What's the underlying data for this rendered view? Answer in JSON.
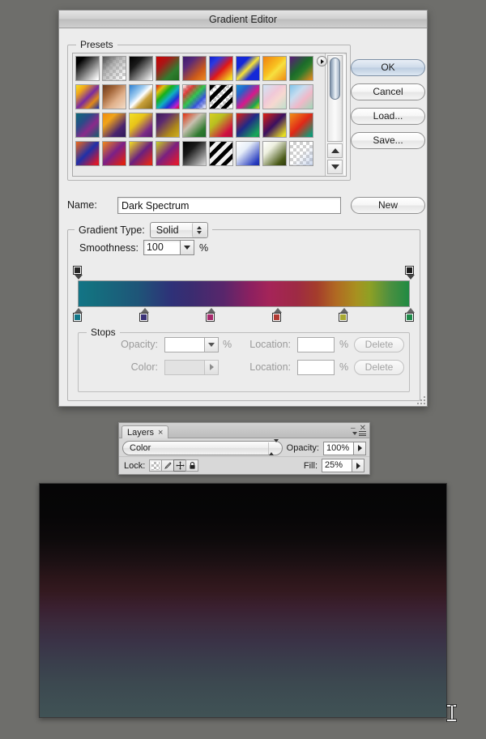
{
  "dialog": {
    "title": "Gradient Editor",
    "buttons": {
      "ok": "OK",
      "cancel": "Cancel",
      "load": "Load...",
      "save": "Save...",
      "new": "New"
    },
    "presets": {
      "title": "Presets",
      "swatches": [
        {
          "name": "black-white",
          "css": "linear-gradient(135deg,#000 0%,#000 18%,#ffffff 95%)"
        },
        {
          "name": "foreground-to-transparent",
          "css": "linear-gradient(135deg,#4d4d4d 0%,rgba(160,160,160,0.75) 40%,rgba(255,255,255,0) 92%)"
        },
        {
          "name": "black-white-soft",
          "css": "linear-gradient(135deg,#000 0%,#1a1a1a 30%,#ffffff 100%)"
        },
        {
          "name": "red-green",
          "css": "linear-gradient(135deg,#cc0000 0%,#a81818 30%,#2f7d2f 70%,#1e6b1e 100%)"
        },
        {
          "name": "violet-orange",
          "css": "linear-gradient(135deg,#3b1a6e 0%,#5a2a78 28%,#cc5a1a 70%,#ef8a1e 100%)"
        },
        {
          "name": "blue-red-yellow",
          "css": "linear-gradient(135deg,#1020d0 0%,#2a3ae0 22%,#e01818 55%,#f0d020 90%,#f8e840 100%)"
        },
        {
          "name": "blue-yellow-blue",
          "css": "linear-gradient(135deg,#1428d8 0%,#1428d8 28%,#f5e238 50%,#1428d8 72%,#1428d8 100%)"
        },
        {
          "name": "orange-yellow-orange",
          "css": "linear-gradient(135deg,#f08010 0%,#f8c020 45%,#f7e040 58%,#ef8a14 100%)"
        },
        {
          "name": "violet-green-orange",
          "css": "linear-gradient(135deg,#5c1a7a 0%,#1c6b2a 45%,#2b7a2b 60%,#ef8a1e 100%)"
        },
        {
          "name": "yellow-violet-orange-blue",
          "css": "linear-gradient(135deg,#f6e020 0%,#f0a81a 22%,#7a2aa0 52%,#e08a18 74%,#1a2ea8 100%)"
        },
        {
          "name": "copper",
          "css": "linear-gradient(135deg,#6b3a1e 0%,#a4673a 30%,#e0b08a 62%,#f3ddc8 100%)"
        },
        {
          "name": "chrome",
          "css": "linear-gradient(135deg,#2a7fd0 0%,#9ecbf0 34%,#ffffff 50%,#c8a03a 66%,#8a6a14 100%)"
        },
        {
          "name": "spectrum",
          "css": "linear-gradient(135deg,#e01010 0%,#e0c010 18%,#18b018 36%,#10b0c0 54%,#2030d8 72%,#c020c8 88%,#e01010 100%)"
        },
        {
          "name": "transparent-rainbow",
          "css": "linear-gradient(135deg,rgba(255,0,0,0) 0%,rgba(220,30,30,.85) 22%,rgba(30,190,60,.9) 48%,rgba(40,70,220,.9) 72%,rgba(200,40,200,0) 100%)"
        },
        {
          "name": "transparent-stripes",
          "css": "repeating-linear-gradient(135deg,#000 0 5px,rgba(255,255,255,0) 5px 10px)"
        },
        {
          "name": "blue-magenta-green",
          "css": "linear-gradient(135deg,#1896d8 0%,#2a60c8 26%,#d8188c 56%,#18a84c 82%,#ead818 100%)"
        },
        {
          "name": "pastel-pink",
          "css": "linear-gradient(135deg,#cfe4f5 0%,#f0c8d8 40%,#f6d8d0 62%,#bfe0cc 100%)"
        },
        {
          "name": "pastel-blue-pink",
          "css": "linear-gradient(135deg,#7fc4ea 0%,#c8dcef 34%,#f0b8c8 62%,#9fd8b8 100%)"
        },
        {
          "name": "teal-violet",
          "css": "linear-gradient(135deg,#0d6a78 0%,#2c4a88 34%,#8a2a8a 62%,#14606e 100%)"
        },
        {
          "name": "orange-violet",
          "css": "linear-gradient(135deg,#ef8a10 0%,#f0a418 28%,#4a2470 70%,#2e1a58 100%)"
        },
        {
          "name": "yellow-violet",
          "css": "linear-gradient(135deg,#f2e028 0%,#e8c418 35%,#7a2a88 75%,#5a1c6c 100%)"
        },
        {
          "name": "violet-olive",
          "css": "linear-gradient(135deg,#3a1a5c 0%,#5c2a70 30%,#b08a18 72%,#d0b020 100%)"
        },
        {
          "name": "red-gray-green",
          "css": "linear-gradient(135deg,#e03010 0%,#c8c0b0 40%,#2f7a2f 78%,#1e6a2a 100%)"
        },
        {
          "name": "olive-crimson",
          "css": "linear-gradient(135deg,#d8d020 0%,#b8c020 32%,#d01040 78%,#b01038 100%)"
        },
        {
          "name": "red-navy-green",
          "css": "linear-gradient(135deg,#e02010 0%,#202a88 46%,#18a858 88%,#14904c 100%)"
        },
        {
          "name": "red-violet-yellow",
          "css": "linear-gradient(135deg,#e02010 0%,#3a1060 48%,#e8e020 92%,#d8d018 100%)"
        },
        {
          "name": "orange-red-teal",
          "css": "linear-gradient(135deg,#f09018 0%,#e02818 48%,#109a78 92%,#0c8a6c 100%)"
        },
        {
          "name": "orange-blue-red",
          "css": "linear-gradient(135deg,#f06818 0%,#2030a8 48%,#e01828 92%,#d01020 100%)"
        },
        {
          "name": "orange-violet-red",
          "css": "linear-gradient(135deg,#f08818 0%,#7a2088 48%,#e02010 92%,#d01808 100%)"
        },
        {
          "name": "yellow-violet-red",
          "css": "linear-gradient(135deg,#f3e020 0%,#6a2080 50%,#e02818 92%,#d02010 100%)"
        },
        {
          "name": "olive-violet-red",
          "css": "linear-gradient(135deg,#c8d020 0%,#7a2080 48%,#e01830 92%,#d01028 100%)"
        },
        {
          "name": "black-gray",
          "css": "linear-gradient(135deg,#000 0%,#1a1a1a 34%,#b8b8b8 88%,#d8d8d8 100%)"
        },
        {
          "name": "black-stripes",
          "css": "repeating-linear-gradient(135deg,#000 0 5px,#f2f2f2 5px 10px)"
        },
        {
          "name": "white-blue",
          "css": "linear-gradient(135deg,#ffffff 0%,#e6eef8 34%,#2a3ec0 86%,#1a2aa8 100%)"
        },
        {
          "name": "white-olive",
          "css": "linear-gradient(135deg,#ffffff 0%,#eef0e0 30%,#4a5a18 80%,#2e3a0c 100%)"
        },
        {
          "name": "transparent-white",
          "css": "linear-gradient(135deg,rgba(255,255,255,0) 0%,rgba(255,255,255,0.1) 50%,rgba(160,180,220,0.55) 100%)"
        }
      ]
    },
    "name": {
      "label": "Name:",
      "value": "Dark Spectrum"
    },
    "gradient_type": {
      "label": "Gradient Type:",
      "value": "Solid"
    },
    "smoothness": {
      "label": "Smoothness:",
      "value": "100",
      "unit": "%"
    },
    "gradient_bar": {
      "css": "linear-gradient(to right,#137486 0%,#14707f 4%,#1e5578 18%,#2e3178 28%,#3a2c70 34%,#59266b 44%,#8c2060 52%,#a52458 58%,#9e2a44 66%,#a43c2c 72%,#b06a22 78%,#a89020 84%,#8fa024 88%,#4e9040 94%,#1f8a43 100%)",
      "opacity_stops": [
        {
          "name": "opacity-stop-left",
          "position_pct": 0,
          "color": "#262626"
        },
        {
          "name": "opacity-stop-right",
          "position_pct": 100,
          "color": "#1c1c1c"
        }
      ],
      "color_stops": [
        {
          "name": "color-stop-teal",
          "position_pct": 0,
          "color": "#117688"
        },
        {
          "name": "color-stop-navy",
          "position_pct": 20,
          "color": "#3a3277"
        },
        {
          "name": "color-stop-magenta",
          "position_pct": 40,
          "color": "#a62a6c"
        },
        {
          "name": "color-stop-red",
          "position_pct": 60,
          "color": "#b23a33"
        },
        {
          "name": "color-stop-olive",
          "position_pct": 80,
          "color": "#a8a832"
        },
        {
          "name": "color-stop-green",
          "position_pct": 100,
          "color": "#1f8a4a"
        }
      ]
    },
    "stops": {
      "title": "Stops",
      "opacity_label": "Opacity:",
      "opacity_value": "",
      "opacity_unit": "%",
      "color_label": "Color:",
      "location_label": "Location:",
      "location_opacity_value": "",
      "location_color_value": "",
      "location_unit": "%",
      "delete_label": "Delete"
    }
  },
  "layers_panel": {
    "tab_label": "Layers",
    "tab_close": "×",
    "minimize": "–",
    "close": "✕",
    "blend_mode": "Color",
    "opacity_label": "Opacity:",
    "opacity_value": "100%",
    "lock_label": "Lock:",
    "fill_label": "Fill:",
    "fill_value": "25%",
    "lock_buttons": [
      {
        "name": "lock-transparency-icon",
        "glyph": ""
      },
      {
        "name": "lock-image-pixels-brush-icon",
        "glyph": "✐"
      },
      {
        "name": "lock-position-move-icon",
        "glyph": "✣"
      },
      {
        "name": "lock-all-padlock-icon",
        "glyph": "ὑ2"
      }
    ]
  },
  "canvas": {
    "name": "document-canvas",
    "gradient_description": "dark vertical gradient black to slate blue"
  },
  "colors": {
    "window_background": "#6e6e6b",
    "dialog_background": "#ececec",
    "accent_default_button": "#cfdcea"
  }
}
